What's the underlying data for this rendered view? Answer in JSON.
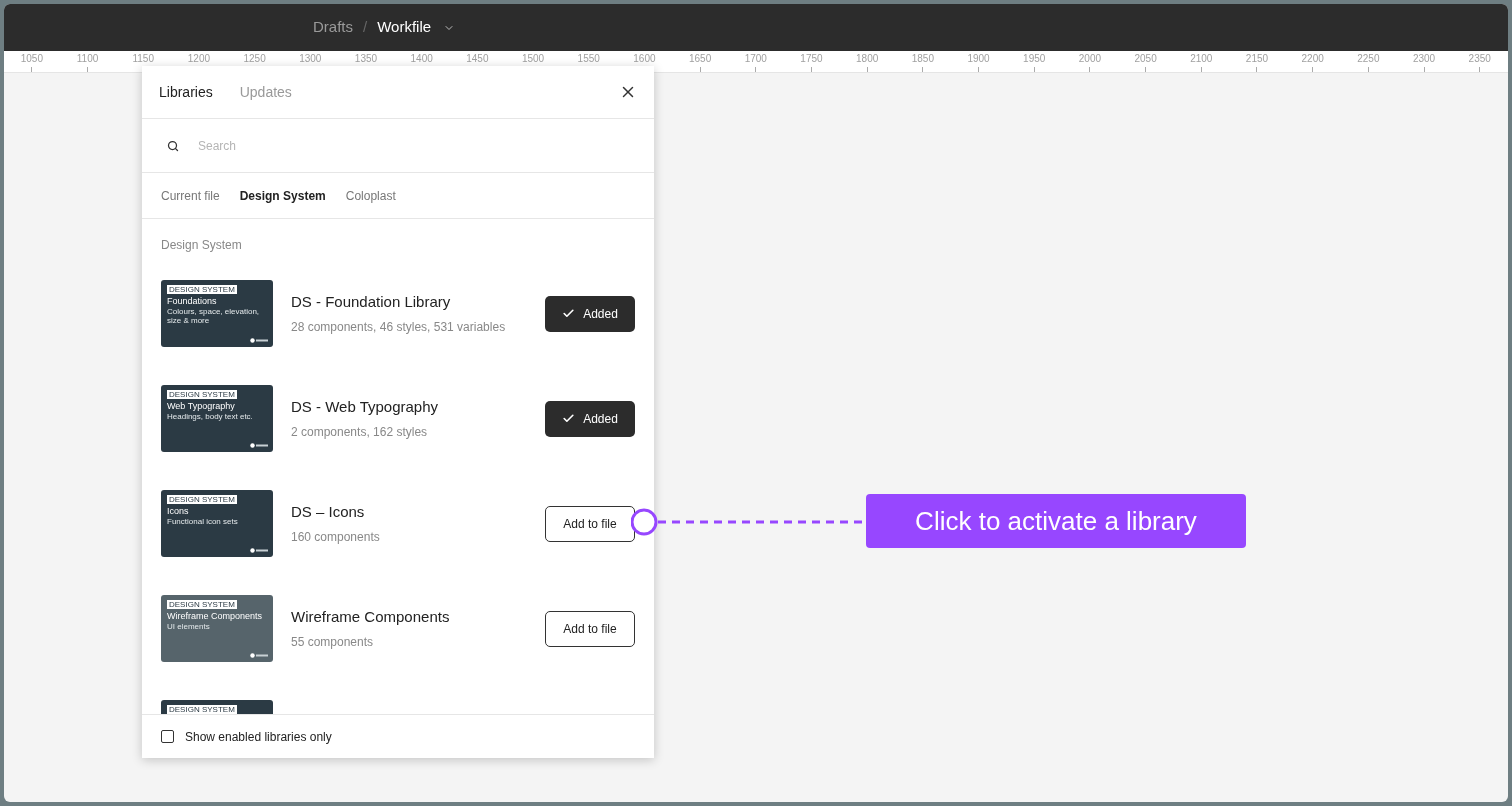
{
  "header": {
    "breadcrumb": "Drafts",
    "separator": "/",
    "file": "Workfile"
  },
  "ruler": [
    "1050",
    "1100",
    "1150",
    "1200",
    "1250",
    "1300",
    "1350",
    "1400",
    "1450",
    "1500",
    "1550",
    "1600",
    "1650",
    "1700",
    "1750",
    "1800",
    "1850",
    "1900",
    "1950",
    "2000",
    "2050",
    "2100",
    "2150",
    "2200",
    "2250",
    "2300",
    "2350"
  ],
  "panel": {
    "tabs": [
      {
        "label": "Libraries",
        "selected": true
      },
      {
        "label": "Updates",
        "selected": false
      }
    ],
    "search": {
      "placeholder": "Search"
    },
    "filters": [
      {
        "label": "Current file",
        "selected": false
      },
      {
        "label": "Design System",
        "selected": true
      },
      {
        "label": "Coloplast",
        "selected": false
      }
    ],
    "section": "Design System",
    "libraries": [
      {
        "name": "DS - Foundation Library",
        "details": "28 components, 46 styles, 531 variables",
        "added": true,
        "button": "Added",
        "thumbnail": {
          "badge": "DESIGN SYSTEM",
          "title": "Foundations",
          "subtitle": "Colours, space, elevation, size & more",
          "color": "#2b3a44"
        }
      },
      {
        "name": "DS - Web Typography",
        "details": "2 components, 162 styles",
        "added": true,
        "button": "Added",
        "thumbnail": {
          "badge": "DESIGN SYSTEM",
          "title": "Web Typography",
          "subtitle": "Headings, body text etc.",
          "color": "#2b3a44"
        }
      },
      {
        "name": "DS – Icons",
        "details": "160 components",
        "added": false,
        "button": "Add to file",
        "thumbnail": {
          "badge": "DESIGN SYSTEM",
          "title": "Icons",
          "subtitle": "Functional icon sets",
          "color": "#2b3a44"
        }
      },
      {
        "name": "Wireframe Components",
        "details": "55 components",
        "added": false,
        "button": "Add to file",
        "thumbnail": {
          "badge": "DESIGN SYSTEM",
          "title": "Wireframe Components",
          "subtitle": "UI elements",
          "color": "#56646b"
        }
      },
      {
        "thumbnail": {
          "badge": "DESIGN SYSTEM",
          "color": "#2b3a44"
        }
      }
    ],
    "footer": {
      "label": "Show enabled libraries only",
      "checked": false
    }
  },
  "callout": {
    "label": "Click to activate a library"
  }
}
